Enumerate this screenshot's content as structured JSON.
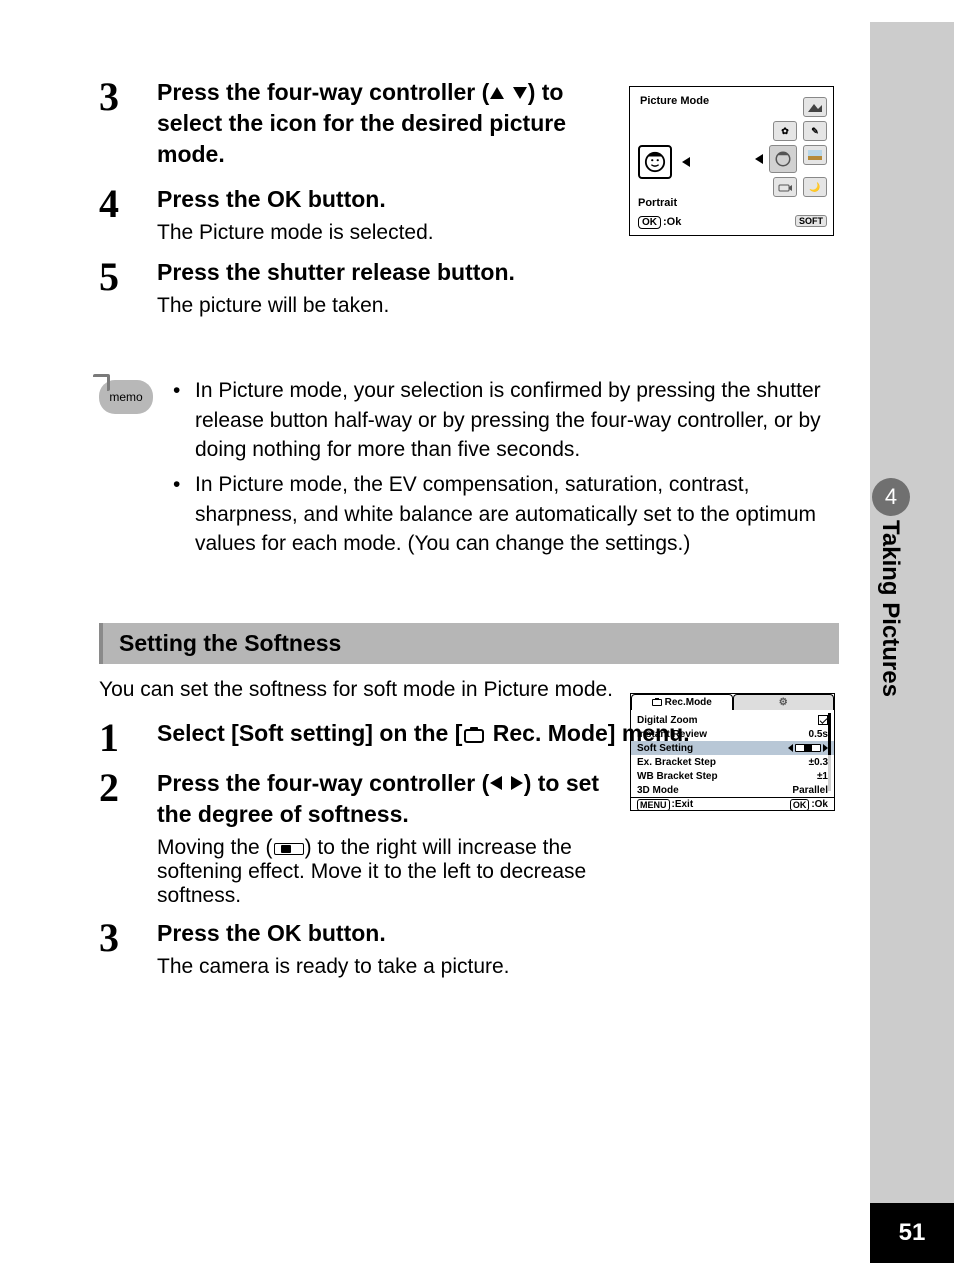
{
  "sidebar": {
    "chapter_number": "4",
    "chapter_title": "Taking Pictures",
    "page_number": "51"
  },
  "steps_a": {
    "s3": {
      "num": "3",
      "head_a": "Press the four-way controller (",
      "head_b": ") to select the icon for the desired picture mode."
    },
    "s4": {
      "num": "4",
      "head": "Press the OK button.",
      "sub": "The Picture mode is selected."
    },
    "s5": {
      "num": "5",
      "head": "Press the shutter release button.",
      "sub": "The picture will be taken."
    }
  },
  "memo": {
    "label": "memo",
    "b1": "In Picture mode, your selection is confirmed by pressing the shutter release button half-way or by pressing the four-way controller, or by doing nothing for more than five seconds.",
    "b2": "In Picture mode, the EV compensation, saturation, contrast, sharpness, and white balance are automatically set to the optimum values for each mode. (You can change the settings.)"
  },
  "section": {
    "title": "Setting the Softness",
    "intro": "You can set the softness for soft mode in Picture mode."
  },
  "steps_b": {
    "s1": {
      "num": "1",
      "head_a": "Select [Soft setting] on the [",
      "head_b": " Rec. Mode] menu."
    },
    "s2": {
      "num": "2",
      "head_a": "Press the four-way controller (",
      "head_b": ") to set the degree of softness.",
      "sub_a": "Moving the (",
      "sub_b": ") to the right will increase the softening effect. Move it to the left to decrease softness."
    },
    "s3": {
      "num": "3",
      "head": "Press the OK button.",
      "sub": "The camera is ready to take a picture."
    }
  },
  "lcd1": {
    "title": "Picture Mode",
    "selected": "Portrait",
    "ok_pill": "OK",
    "ok_label": ":Ok",
    "soft": "SOFT"
  },
  "lcd2": {
    "tab_active": "Rec.Mode",
    "rows": {
      "r1": {
        "label": "Digital Zoom"
      },
      "r2": {
        "label": "Instant Review",
        "value": "0.5s"
      },
      "r3": {
        "label": "Soft Setting"
      },
      "r4": {
        "label": "Ex. Bracket Step",
        "value": "±0.3"
      },
      "r5": {
        "label": "WB Bracket Step",
        "value": "±1"
      },
      "r6": {
        "label": "3D Mode",
        "value": "Parallel"
      }
    },
    "menu_pill": "MENU",
    "exit": ":Exit",
    "ok_pill": "OK",
    "ok": ":Ok"
  }
}
